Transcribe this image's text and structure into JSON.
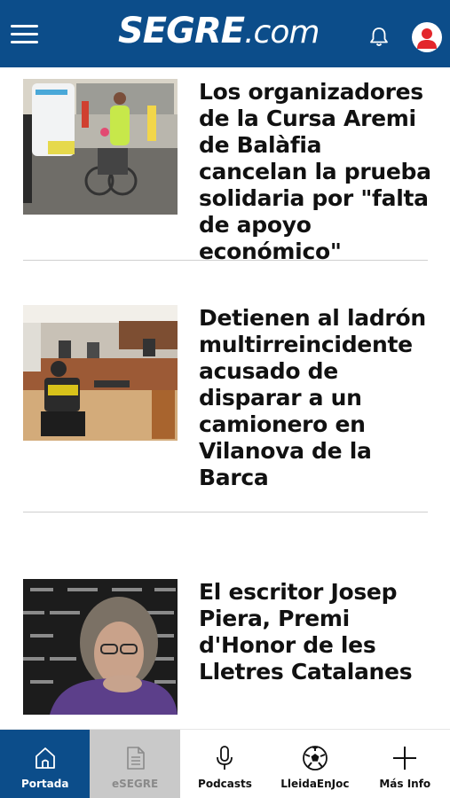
{
  "header": {
    "logo_brand": "SEGRE",
    "logo_tld": ".com",
    "menu_icon": "hamburger-icon",
    "notification_icon": "bell-icon",
    "account_icon": "user-icon",
    "bar_color": "#0c4d8a"
  },
  "articles": [
    {
      "headline": "Los organizadores de la Cursa Aremi de Balàfia cancelan la prueba solidaria por \"falta de apoyo económico\""
    },
    {
      "headline": "Detienen al ladrón multirreincidente acusado de disparar a un camionero en Vilanova de la Barca"
    },
    {
      "headline": "El escritor Josep Piera, Premi d'Honor de les Lletres Catalanes"
    }
  ],
  "tabs": [
    {
      "label": "Portada",
      "icon": "home-icon",
      "state": "active"
    },
    {
      "label": "eSEGRE",
      "icon": "document-icon",
      "state": "disabled"
    },
    {
      "label": "Podcasts",
      "icon": "microphone-icon",
      "state": "normal"
    },
    {
      "label": "LleidaEnJoc",
      "icon": "football-icon",
      "state": "normal"
    },
    {
      "label": "Más Info",
      "icon": "plus-icon",
      "state": "normal"
    }
  ]
}
